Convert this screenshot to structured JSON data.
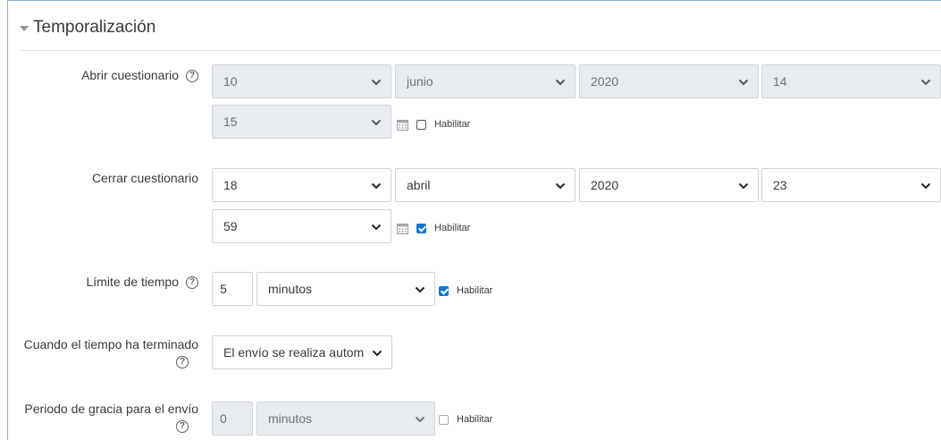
{
  "section": {
    "title": "Temporalización"
  },
  "open_quiz": {
    "label": "Abrir cuestionario",
    "day": "10",
    "month": "junio",
    "year": "2020",
    "hour": "14",
    "minute": "15",
    "enable_label": "Habilitar",
    "enabled": false
  },
  "close_quiz": {
    "label": "Cerrar cuestionario",
    "day": "18",
    "month": "abril",
    "year": "2020",
    "hour": "23",
    "minute": "59",
    "enable_label": "Habilitar",
    "enabled": true
  },
  "time_limit": {
    "label": "Límite de tiempo",
    "value": "5",
    "unit": "minutos",
    "enable_label": "Habilitar",
    "enabled": true
  },
  "when_time_ends": {
    "label": "Cuando el tiempo ha terminado",
    "value": "El envío se realiza automáticamente"
  },
  "grace_period": {
    "label": "Periodo de gracia para el envío",
    "value": "0",
    "unit": "minutos",
    "enable_label": "Habilitar",
    "enabled": false
  },
  "icons": {
    "help": "help-circle-icon",
    "calendar": "calendar-icon",
    "chevron": "chevron-down-icon",
    "collapse": "caret-down-icon"
  },
  "colors": {
    "accent": "#1177d1",
    "disabled_bg": "#e9ecef",
    "border": "#ced4da"
  }
}
